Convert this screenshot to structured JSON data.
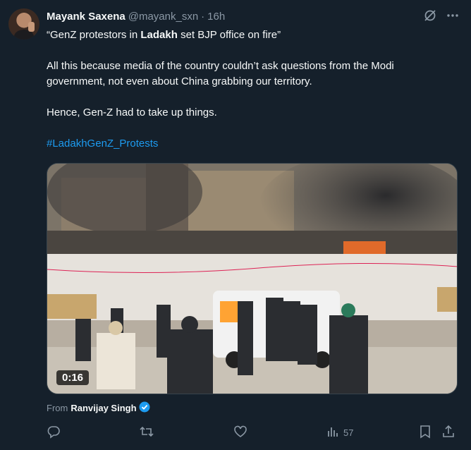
{
  "author": {
    "name": "Mayank Saxena",
    "handle": "@mayank_sxn",
    "separator": "·",
    "time": "16h"
  },
  "tweet": {
    "line1_pre": "“GenZ protestors in ",
    "line1_bold": "Ladakh",
    "line1_post": " set BJP office on fire”",
    "para2": "All this because media of the country couldn’t ask questions from the Modi government, not even about China grabbing our territory.",
    "para3": "Hence, Gen-Z had to take up things.",
    "hashtag": "#LadakhGenZ_Protests"
  },
  "media": {
    "duration": "0:16"
  },
  "attribution": {
    "prefix": "From",
    "name": "Ranvijay Singh"
  },
  "actions": {
    "views": "57"
  },
  "icons": [
    "grok-icon",
    "more-icon",
    "reply-icon",
    "retweet-icon",
    "like-icon",
    "views-icon",
    "bookmark-icon",
    "share-icon",
    "verified-icon"
  ],
  "colors": {
    "background": "#15202b",
    "accent": "#1d9bf0",
    "muted": "#8b98a5",
    "text": "#f7f9f9"
  }
}
